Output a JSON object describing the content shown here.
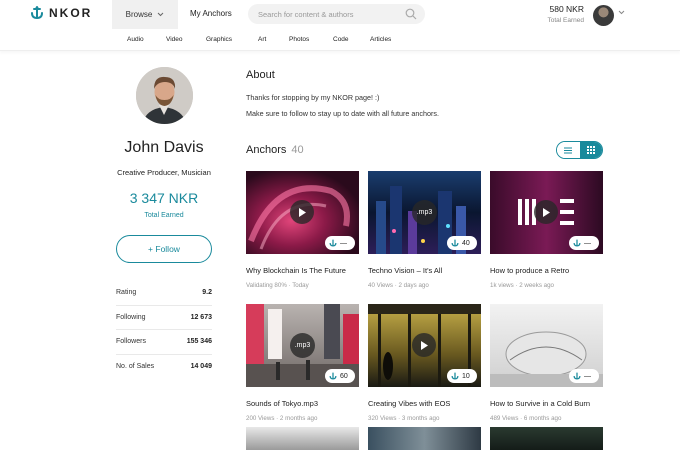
{
  "header": {
    "logo_text": "NKOR",
    "browse_label": "Browse",
    "my_anchors_label": "My Anchors",
    "search_placeholder": "Search for content & authors",
    "balance_value": "580 NKR",
    "balance_label": "Total Earned"
  },
  "subnav": [
    "Audio",
    "Video",
    "Graphics",
    "Art",
    "Photos",
    "Code",
    "Articles"
  ],
  "profile": {
    "name": "John Davis",
    "role": "Creative Producer, Musician",
    "earned_value": "3 347 NKR",
    "earned_label": "Total Earned",
    "follow_label": "+ Follow",
    "stats": [
      {
        "label": "Rating",
        "value": "9.2"
      },
      {
        "label": "Following",
        "value": "12 673"
      },
      {
        "label": "Followers",
        "value": "155 346"
      },
      {
        "label": "No. of Sales",
        "value": "14 049"
      }
    ]
  },
  "about": {
    "title": "About",
    "line1": "Thanks for stopping by my NKOR page! :)",
    "line2": "Make sure to follow to stay up to date with all future anchors."
  },
  "anchors": {
    "title": "Anchors",
    "count": "40",
    "cards": [
      {
        "title": "Why Blockchain Is The Future",
        "meta": "Validating 80%  ·  Today",
        "badge": "—",
        "media": "play"
      },
      {
        "title": "Techno Vision – It's All",
        "meta": "40 Views  ·  2 days ago",
        "badge": "40",
        "media": "mp3",
        "media_label": ".mp3"
      },
      {
        "title": "How to produce a Retro",
        "meta": "1k views  ·  2 weeks ago",
        "badge": "—",
        "media": "play"
      },
      {
        "title": "Sounds of Tokyo.mp3",
        "meta": "200 Views  ·  2 months ago",
        "badge": "60",
        "media": "mp3",
        "media_label": ".mp3"
      },
      {
        "title": "Creating Vibes with EOS",
        "meta": "320 Views  ·  3 months ago",
        "badge": "10",
        "media": "play"
      },
      {
        "title": "How to Survive in a Cold Burn",
        "meta": "489 Views  ·  6 months ago",
        "badge": "—",
        "media": "none"
      }
    ]
  },
  "colors": {
    "accent": "#1a8a9c"
  }
}
